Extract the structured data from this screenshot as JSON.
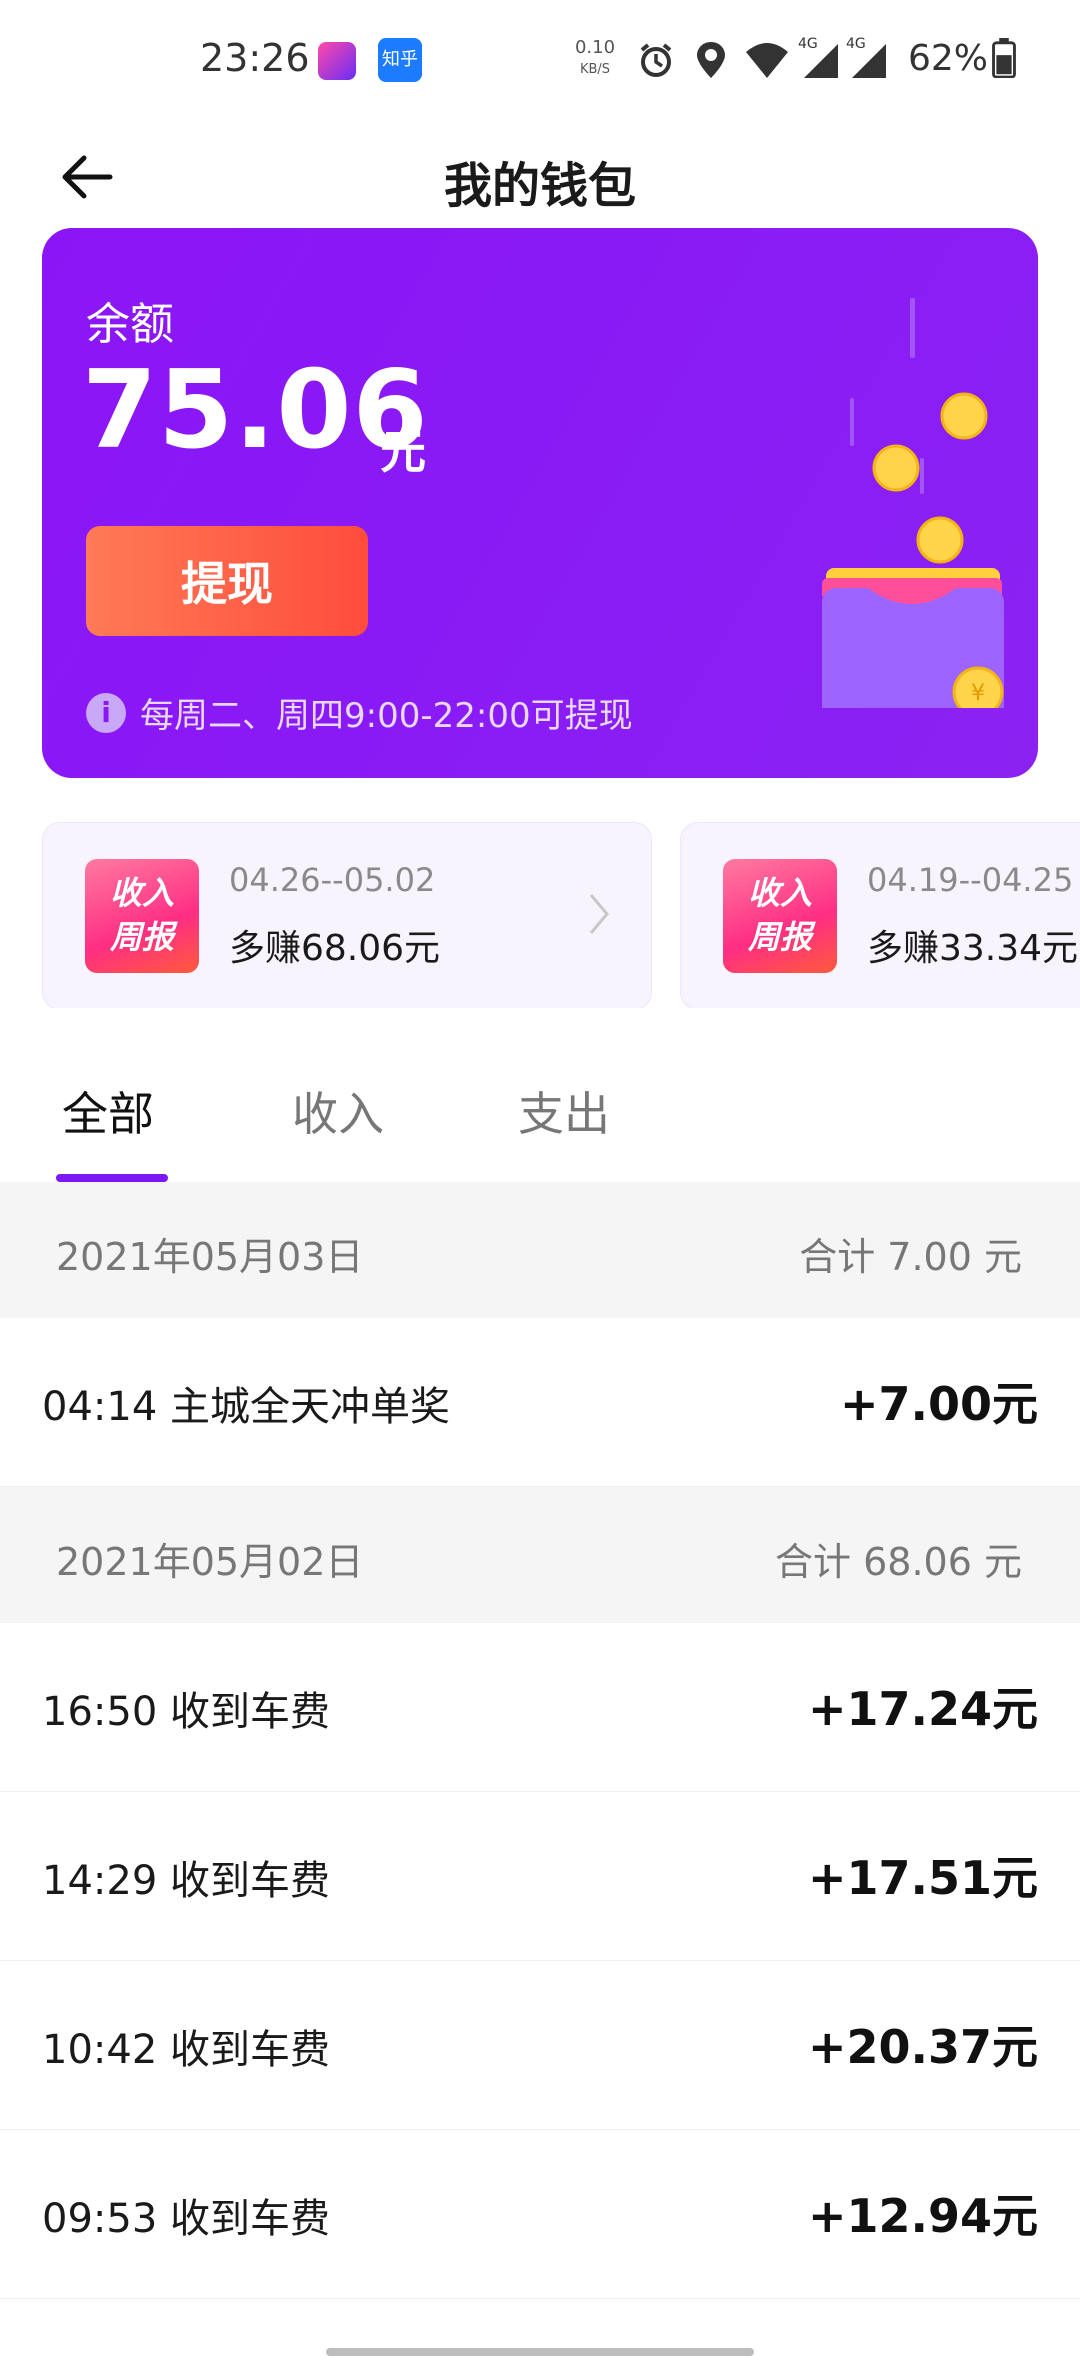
{
  "status_bar": {
    "time": "23:26",
    "app_icon_label": "知乎",
    "net_speed_value": "0.10",
    "net_speed_unit": "KB/S",
    "signal_1": "4G",
    "signal_2": "4G",
    "battery": "62%"
  },
  "header": {
    "title": "我的钱包",
    "back_icon": "arrow-left-icon"
  },
  "balance": {
    "label": "余额",
    "amount": "75.06",
    "unit": "元",
    "withdraw_label": "提现",
    "info_text": "每周二、周四9:00-22:00可提现",
    "colors": {
      "card": "#8a18f5",
      "button": "#ff5a44"
    }
  },
  "weekly_reports": [
    {
      "badge_line1": "收入",
      "badge_line2": "周报",
      "dates": "04.26--05.02",
      "earned": "多赚68.06元"
    },
    {
      "badge_line1": "收入",
      "badge_line2": "周报",
      "dates": "04.19--04.25",
      "earned": "多赚33.34元"
    }
  ],
  "tabs": [
    {
      "label": "全部",
      "active": true
    },
    {
      "label": "收入",
      "active": false
    },
    {
      "label": "支出",
      "active": false
    }
  ],
  "days": [
    {
      "date": "2021年05月03日",
      "total": "合计 7.00 元",
      "transactions": [
        {
          "desc": "04:14 主城全天冲单奖",
          "amount": "+7.00元"
        }
      ]
    },
    {
      "date": "2021年05月02日",
      "total": "合计 68.06 元",
      "transactions": [
        {
          "desc": "16:50 收到车费",
          "amount": "+17.24元"
        },
        {
          "desc": "14:29 收到车费",
          "amount": "+17.51元"
        },
        {
          "desc": "10:42 收到车费",
          "amount": "+20.37元"
        },
        {
          "desc": "09:53 收到车费",
          "amount": "+12.94元"
        }
      ]
    }
  ]
}
